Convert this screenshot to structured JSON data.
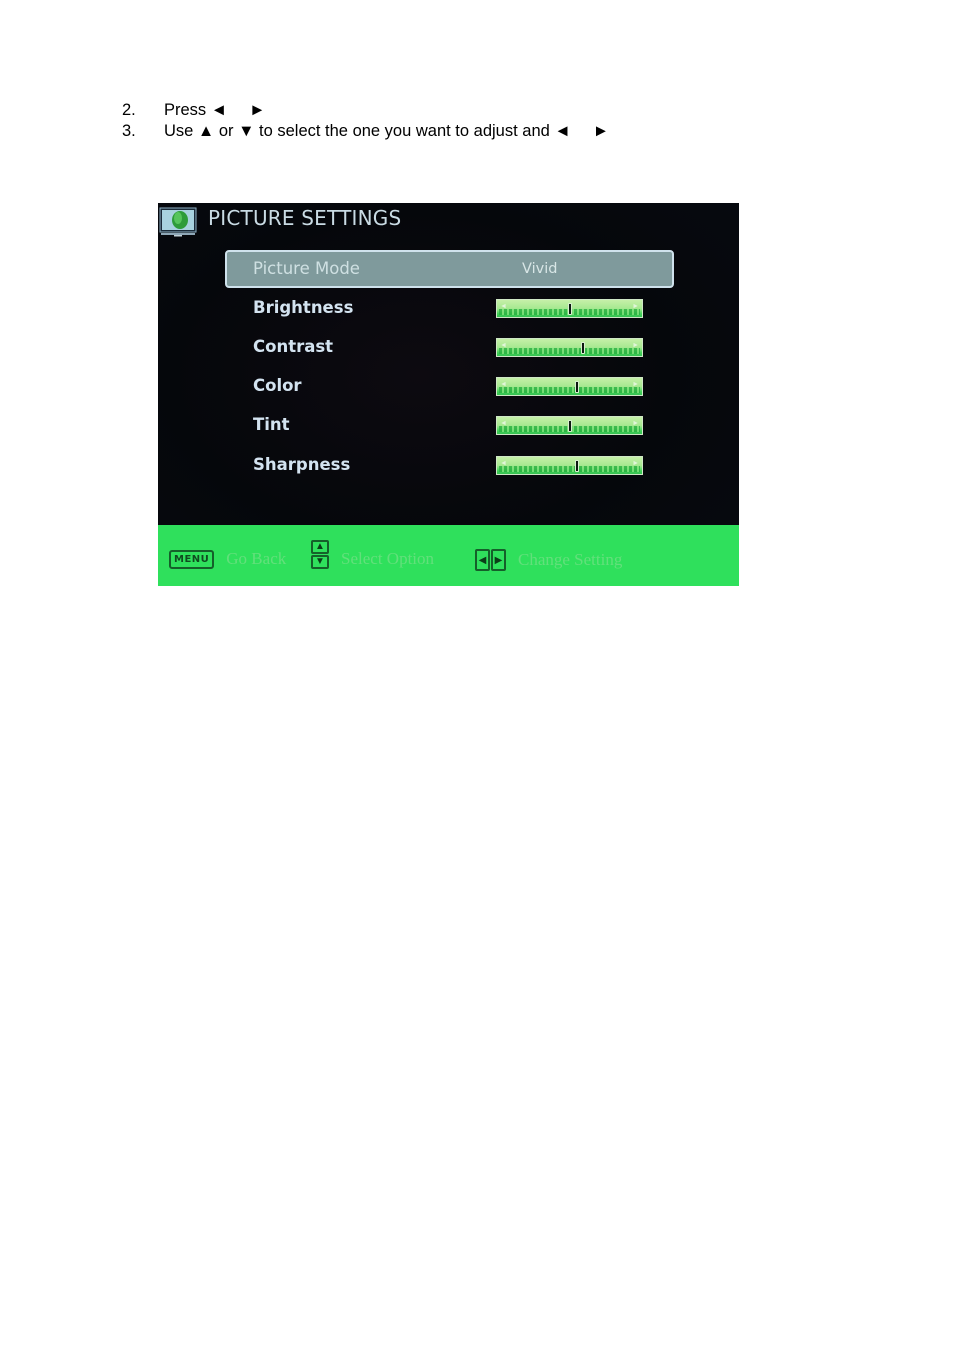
{
  "instructions": [
    {
      "number": "2.",
      "text_before": "Press ",
      "left_arrow": "◄",
      "right_arrow": "►",
      "text_after": ""
    },
    {
      "number": "3.",
      "text_before": "Use ▲ or ▼ to select the one you want to adjust and ",
      "left_arrow": "◄",
      "right_arrow": "►",
      "text_after": ""
    }
  ],
  "osd": {
    "title": "PICTURE SETTINGS",
    "icon": "tv-leaf-icon",
    "selected_row": {
      "label": "Picture Mode",
      "value": "Vivid"
    },
    "sliders": [
      {
        "label": "Brightness",
        "value_percent": 50
      },
      {
        "label": "Contrast",
        "value_percent": 59
      },
      {
        "label": "Color",
        "value_percent": 55
      },
      {
        "label": "Tint",
        "value_percent": 50
      },
      {
        "label": "Sharpness",
        "value_percent": 55
      }
    ],
    "slider_arrows": {
      "left": "◄",
      "right": "►"
    },
    "footer": {
      "menu_key": "MENU",
      "go_back": "Go Back",
      "up_key": "▲",
      "down_key": "▼",
      "select_option": "Select Option",
      "left_key": "◀",
      "right_key": "▶",
      "change_setting": "Change Setting"
    },
    "colors": {
      "footer_bg": "#2fe05c",
      "selected_bg": "#7f9a9c",
      "slider_green": "#44d45a"
    }
  }
}
